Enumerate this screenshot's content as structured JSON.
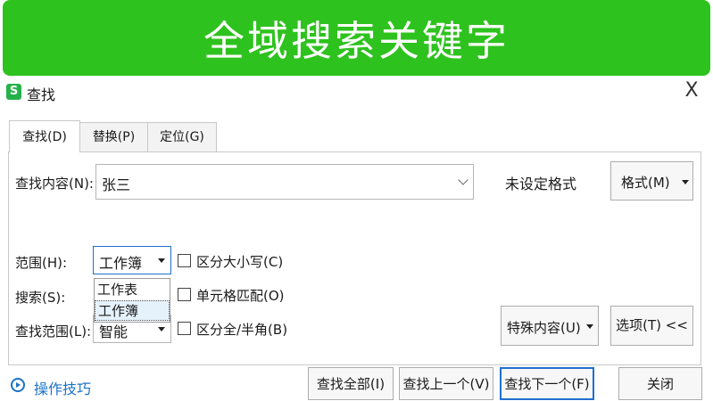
{
  "banner": {
    "text": "全域搜索关键字"
  },
  "dialog": {
    "title": "查找",
    "close_glyph": "X",
    "tabs": [
      {
        "label": "查找(D)"
      },
      {
        "label": "替换(P)"
      },
      {
        "label": "定位(G)"
      }
    ],
    "find_label": "查找内容(N):",
    "find_value": "张三",
    "format_status": "未设定格式",
    "format_button": "格式(M)",
    "scope_label": "范围(H):",
    "scope_value": "工作簿",
    "scope_options": [
      "工作表",
      "工作簿"
    ],
    "search_label": "搜索(S):",
    "lookin_label": "查找范围(L):",
    "lookin_value": "智能",
    "options": {
      "match_case": "区分大小写(C)",
      "match_cell": "单元格匹配(O)",
      "match_width": "区分全/半角(B)"
    },
    "special_button": "特殊内容(U)",
    "options_button": "选项(T) <<",
    "tips": "操作技巧",
    "buttons": {
      "find_all": "查找全部(I)",
      "find_prev": "查找上一个(V)",
      "find_next": "查找下一个(F)",
      "close": "关闭"
    }
  },
  "colors": {
    "banner": "#2ec21e",
    "accent": "#1f6fd0",
    "tips": "#1a73c8"
  }
}
